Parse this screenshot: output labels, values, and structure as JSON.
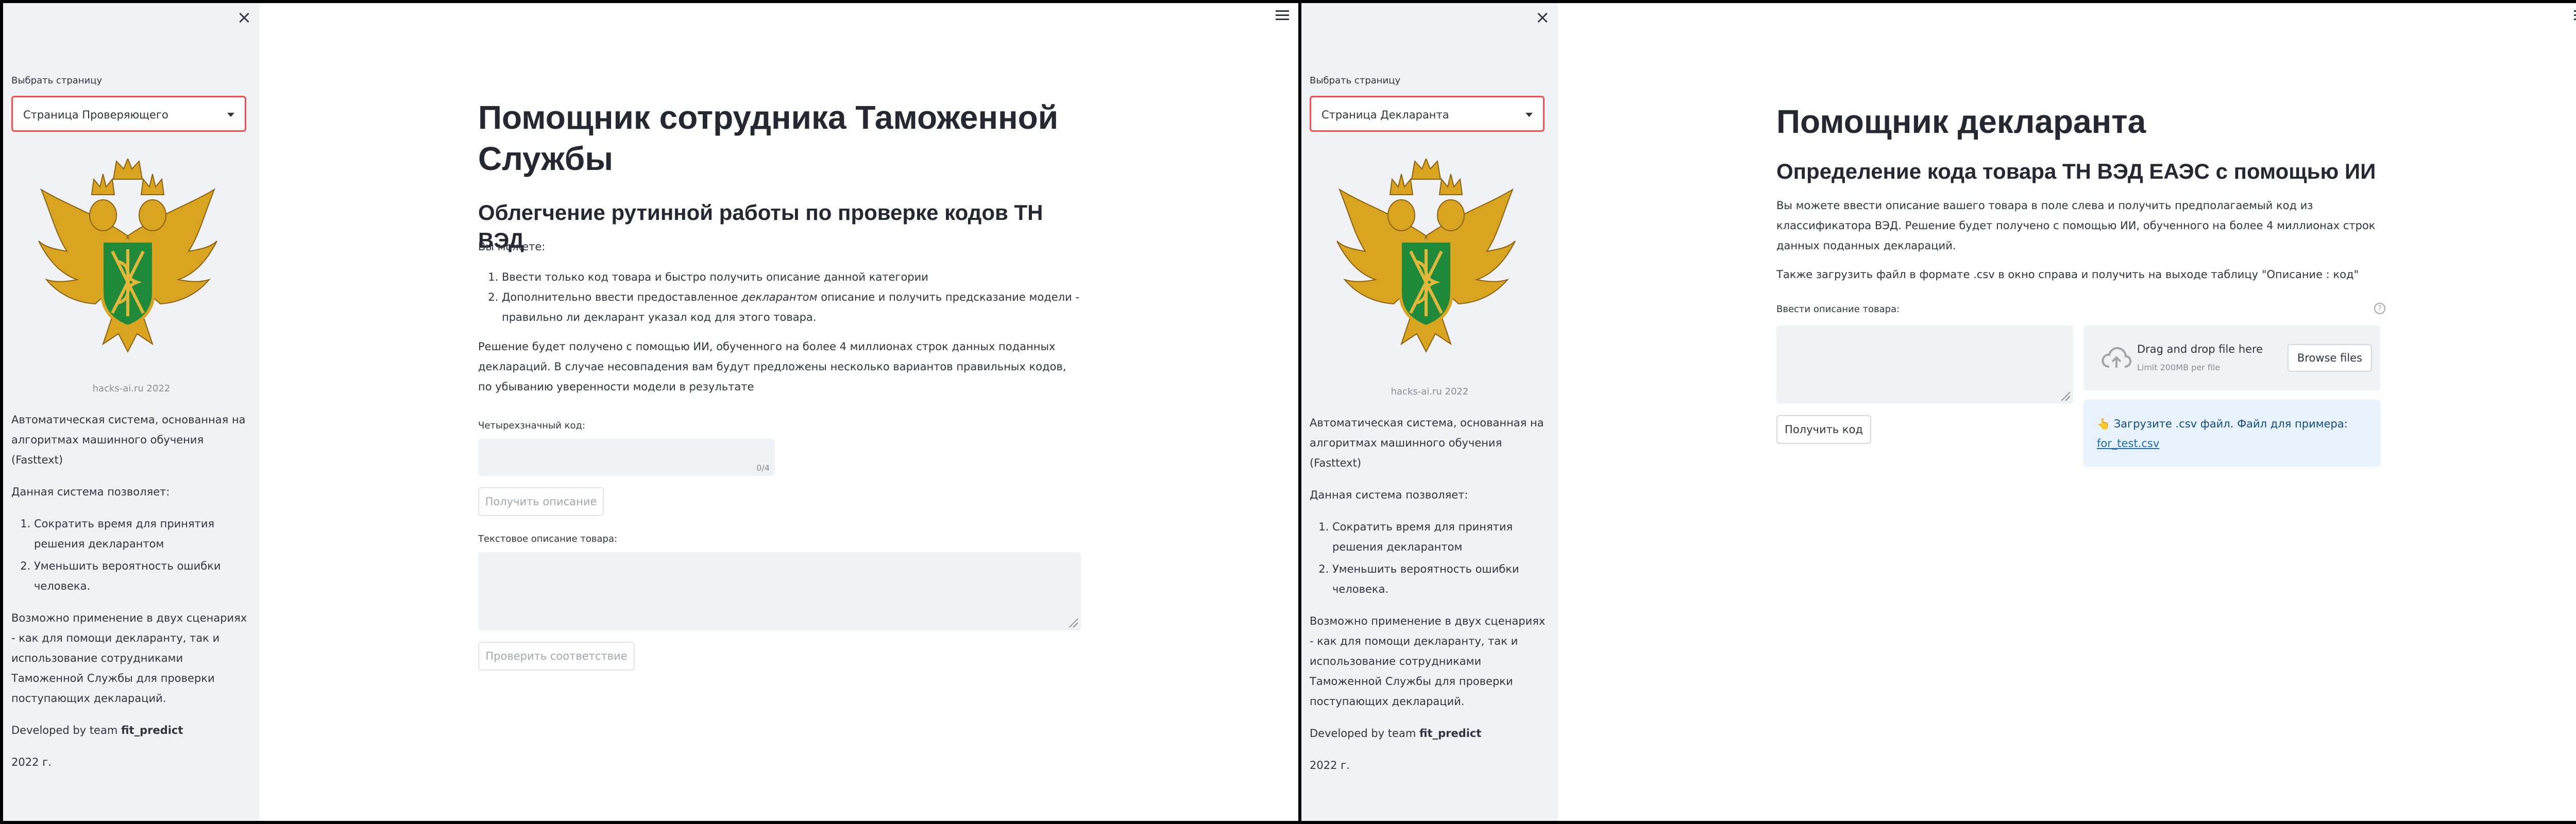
{
  "left": {
    "sidebar": {
      "select_label": "Выбрать страницу",
      "select_value": "Страница Проверяющего",
      "caption": "hacks-ai.ru 2022",
      "desc": "Автоматическая система, основанная на алгоритмах машинного обучения (Fasttext)",
      "allows": "Данная система позволяет:",
      "items": [
        "Сократить время для принятия решения декларантом",
        "Уменьшить вероятность ошибки человека."
      ],
      "usage": "Возможно применение в двух сценариях - как для помощи декларанту, так и использование сотрудниками Таможенной Службы для проверки поступающих деклараций.",
      "dev_prefix": "Developed by team ",
      "dev_team": "fit_predict",
      "year": "2022 г."
    },
    "main": {
      "title": "Помощник сотрудника Таможенной Службы",
      "subtitle": "Облегчение рутинной работы по проверке кодов ТН ВЭД",
      "can": "Вы можете:",
      "item1": "Ввести только код товара и быстро получить описание данной категории",
      "item2_pre": "Дополнительно ввести предоставленное ",
      "item2_em": "декларантом",
      "item2_post": " описание и получить предсказание модели - правильно ли декларант указал код для этого товара.",
      "result": "Решение будет получено с помощью ИИ, обученного на более 4 миллионах строк данных поданных деклараций. В случае несовпадения вам будут предложены несколько вариантов правильных кодов, по убыванию уверенности модели в результате",
      "code_label": "Четырехзначный код:",
      "code_counter": "0/4",
      "get_desc_button": "Получить описание",
      "text_label": "Текстовое описание товара:",
      "check_button": "Проверить соответствие"
    }
  },
  "right": {
    "sidebar": {
      "select_label": "Выбрать страницу",
      "select_value": "Страница Декларанта",
      "caption": "hacks-ai.ru 2022",
      "desc": "Автоматическая система, основанная на алгоритмах машинного обучения (Fasttext)",
      "allows": "Данная система позволяет:",
      "items": [
        "Сократить время для принятия решения декларантом",
        "Уменьшить вероятность ошибки человека."
      ],
      "usage": "Возможно применение в двух сценариях - как для помощи декларанту, так и использование сотрудниками Таможенной Службы для проверки поступающих деклараций.",
      "dev_prefix": "Developed by team ",
      "dev_team": "fit_predict",
      "year": "2022 г."
    },
    "main": {
      "title": "Помощник декларанта",
      "subtitle": "Определение кода товара ТН ВЭД ЕАЭС с помощью ИИ",
      "intro": "Вы можете ввести описание вашего товара в поле слева и получить предполагаемый код из классификатора ВЭД. Решение будет получено с помощью ИИ, обученного на более 4 миллионах строк данных поданных деклараций.",
      "upload_note": "Также загрузить файл в формате .csv в окно справа и получить на выходе таблицу \"Описание : код\"",
      "desc_label": "Ввести описание товара:",
      "get_code_button": "Получить код",
      "dropzone_title": "Drag and drop file here",
      "dropzone_limit": "Limit 200MB per file",
      "browse_button": "Browse files",
      "help_icon": "?",
      "info_emoji": "👆",
      "info_text": " Загрузите .csv файл. Файл для примера:",
      "info_link": "for_test.csv"
    }
  },
  "colors": {
    "accent": "#ff4b4b",
    "sidebar_bg": "#f0f2f6",
    "info_bg": "#e8f2fc",
    "link": "#1c6cb3"
  }
}
